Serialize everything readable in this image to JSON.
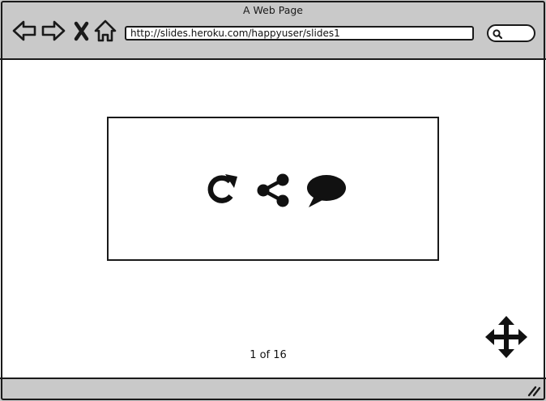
{
  "window": {
    "title": "A Web Page"
  },
  "toolbar": {
    "back_icon": "arrow-left-icon",
    "forward_icon": "arrow-right-icon",
    "stop_icon": "close-icon",
    "home_icon": "home-icon",
    "url": "http://slides.heroku.com/happyuser/slides1",
    "search_icon": "search-icon"
  },
  "slide": {
    "actions": [
      {
        "icon": "refresh-icon"
      },
      {
        "icon": "share-icon"
      },
      {
        "icon": "comment-icon"
      }
    ],
    "page_counter": "1 of 16"
  },
  "viewer": {
    "move_icon": "move-icon"
  },
  "statusbar": {
    "grip_icon": "resize-grip-icon"
  },
  "colors": {
    "chrome": "#c9c9c9",
    "ink": "#1a1a1a",
    "background": "#ffffff"
  }
}
